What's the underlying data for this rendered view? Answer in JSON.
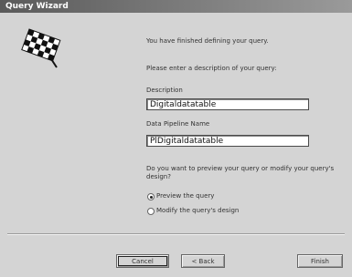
{
  "window": {
    "title": "Query Wizard"
  },
  "intro": "You have finished defining your query.",
  "prompt": "Please enter a description of your query:",
  "description": {
    "label": "Description",
    "value": "Digitaldatatable"
  },
  "pipeline": {
    "label": "Data Pipeline Name",
    "value": "PlDigitaldatatable"
  },
  "question": {
    "line1": "Do you want to preview your query or modify your query's",
    "line2": "design?"
  },
  "options": [
    {
      "label": "Preview the query",
      "selected": true
    },
    {
      "label": "Modify the query's design",
      "selected": false
    }
  ],
  "buttons": {
    "cancel": "Cancel",
    "back": "< Back",
    "finish": "Finish"
  },
  "icons": {
    "wizard": "checkered-flag-icon"
  }
}
